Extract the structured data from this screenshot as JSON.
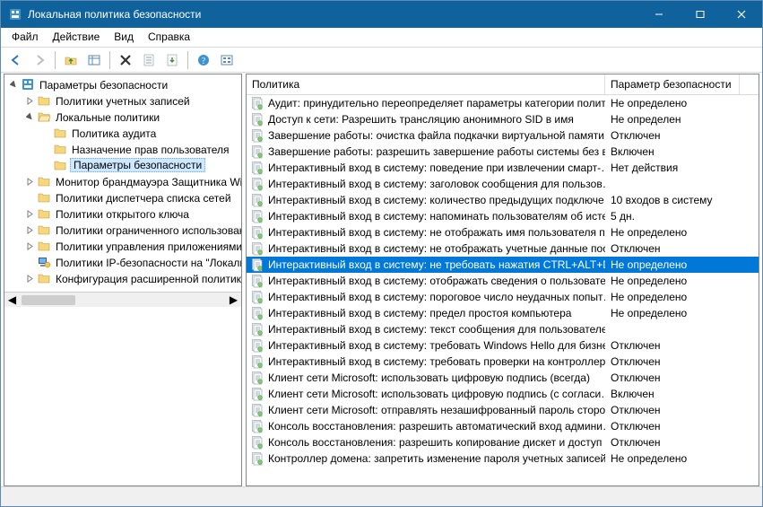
{
  "window": {
    "title": "Локальная политика безопасности"
  },
  "menu": {
    "file": "Файл",
    "action": "Действие",
    "view": "Вид",
    "help": "Справка"
  },
  "columns": {
    "policy": "Политика",
    "setting": "Параметр безопасности",
    "policy_width": 400,
    "setting_width": 150
  },
  "tree": {
    "root": "Параметры безопасности",
    "items": [
      {
        "label": "Политики учетных записей",
        "expandable": true,
        "expanded": false,
        "depth": 1
      },
      {
        "label": "Локальные политики",
        "expandable": true,
        "expanded": true,
        "depth": 1
      },
      {
        "label": "Политика аудита",
        "expandable": false,
        "depth": 2
      },
      {
        "label": "Назначение прав пользователя",
        "expandable": false,
        "depth": 2
      },
      {
        "label": "Параметры безопасности",
        "expandable": false,
        "depth": 2,
        "selected": true,
        "underline": true
      },
      {
        "label": "Монитор брандмауэра Защитника Windows",
        "expandable": true,
        "expanded": false,
        "depth": 1
      },
      {
        "label": "Политики диспетчера списка сетей",
        "expandable": false,
        "depth": 1
      },
      {
        "label": "Политики открытого ключа",
        "expandable": true,
        "expanded": false,
        "depth": 1
      },
      {
        "label": "Политики ограниченного использования программ",
        "expandable": true,
        "expanded": false,
        "depth": 1
      },
      {
        "label": "Политики управления приложениями",
        "expandable": true,
        "expanded": false,
        "depth": 1
      },
      {
        "label": "Политики IP-безопасности на \"Локальный компьютер\"",
        "expandable": false,
        "depth": 1,
        "icon": "ipsec"
      },
      {
        "label": "Конфигурация расширенной политики аудита",
        "expandable": true,
        "expanded": false,
        "depth": 1
      }
    ]
  },
  "policies": [
    {
      "name": "Аудит: принудительно переопределяет параметры категории полит…",
      "value": "Не определено"
    },
    {
      "name": "Доступ к сети: Разрешить трансляцию анонимного SID в имя",
      "value": "Не определен"
    },
    {
      "name": "Завершение работы: очистка файла подкачки виртуальной памяти",
      "value": "Отключен"
    },
    {
      "name": "Завершение работы: разрешить завершение работы системы без в…",
      "value": "Включен"
    },
    {
      "name": "Интерактивный вход в систему:  поведение при извлечении смарт-…",
      "value": "Нет действия"
    },
    {
      "name": "Интерактивный вход в систему: заголовок сообщения для пользов…",
      "value": ""
    },
    {
      "name": "Интерактивный вход в систему: количество предыдущих подключе…",
      "value": "10 входов в систему"
    },
    {
      "name": "Интерактивный вход в систему: напоминать пользователям об исте…",
      "value": "5 дн."
    },
    {
      "name": "Интерактивный вход в систему: не отображать имя пользователя п…",
      "value": "Не определено"
    },
    {
      "name": "Интерактивный вход в систему: не отображать учетные данные пос…",
      "value": "Отключен"
    },
    {
      "name": "Интерактивный вход в систему: не требовать нажатия CTRL+ALT+DEL",
      "value": "Не определено",
      "selected": true,
      "underline": true
    },
    {
      "name": "Интерактивный вход в систему: отображать сведения о пользовате…",
      "value": "Не определено"
    },
    {
      "name": "Интерактивный вход в систему: пороговое число неудачных попыт…",
      "value": "Не определено"
    },
    {
      "name": "Интерактивный вход в систему: предел простоя компьютера",
      "value": "Не определено"
    },
    {
      "name": "Интерактивный вход в систему: текст сообщения для пользователе…",
      "value": ""
    },
    {
      "name": "Интерактивный вход в систему: требовать Windows Hello для бизне…",
      "value": "Отключен"
    },
    {
      "name": "Интерактивный вход в систему: требовать проверки на контроллер…",
      "value": "Отключен"
    },
    {
      "name": "Клиент сети Microsoft: использовать цифровую подпись (всегда)",
      "value": "Отключен"
    },
    {
      "name": "Клиент сети Microsoft: использовать цифровую подпись (с согласи…",
      "value": "Включен"
    },
    {
      "name": "Клиент сети Microsoft: отправлять незашифрованный пароль сторо…",
      "value": "Отключен"
    },
    {
      "name": "Консоль восстановления: разрешить автоматический вход админи…",
      "value": "Отключен"
    },
    {
      "name": "Консоль восстановления: разрешить копирование дискет и доступ …",
      "value": "Отключен"
    },
    {
      "name": "Контроллер домена: запретить изменение пароля учетных записей …",
      "value": "Не определено"
    }
  ]
}
